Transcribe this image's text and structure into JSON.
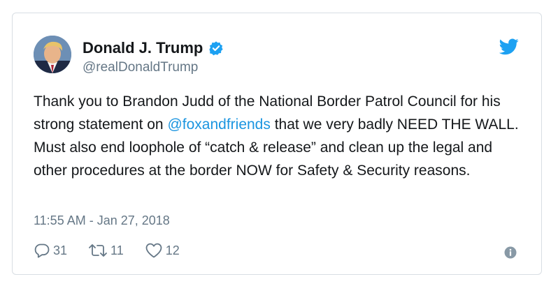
{
  "tweet": {
    "author_name": "Donald J. Trump",
    "author_handle": "@realDonaldTrump",
    "text_segments": [
      "Thank you to Brandon Judd of the National Border Patrol Council for his strong statement on ",
      "@foxandfriends",
      " that we very badly NEED THE WALL. Must also end loophole of “catch & release” and clean up the legal and other procedures at the border NOW for Safety & Security reasons."
    ],
    "timestamp": "11:55 AM - Jan 27, 2018",
    "reply_count": "31",
    "retweet_count": "11",
    "like_count": "12"
  },
  "icons": {
    "verified": "verified-badge-icon",
    "bird": "twitter-bird-icon",
    "reply": "reply-icon",
    "retweet": "retweet-icon",
    "like": "heart-icon",
    "info": "info-icon"
  },
  "colors": {
    "brand_blue": "#1da1f2",
    "link_blue": "#1b95e0",
    "secondary_text": "#657786",
    "border": "#d8dee3"
  }
}
